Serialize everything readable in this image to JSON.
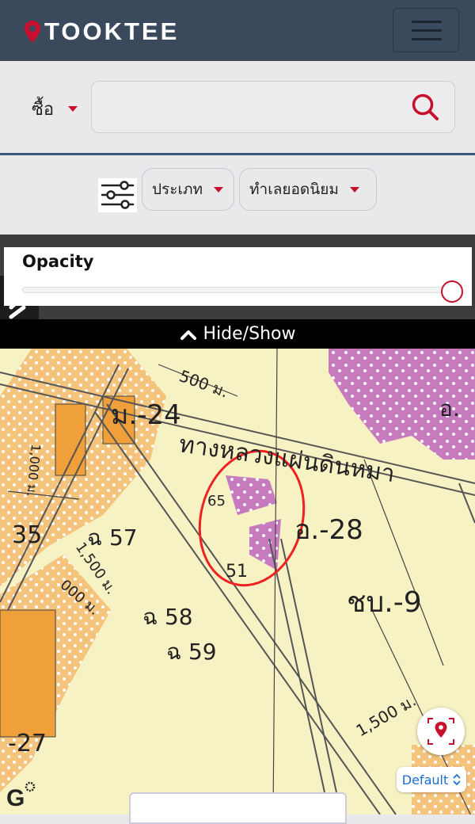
{
  "header": {
    "brand": "TOOKTEE",
    "brand_color": "#3a4a5c",
    "accent": "#c8102e",
    "menu_icon": "hamburger-icon"
  },
  "search": {
    "mode_label": "ซื้อ",
    "placeholder": "",
    "icon": "search-icon"
  },
  "filters": {
    "icon": "sliders-icon",
    "type_label": "ประเภท",
    "location_label": "ทำเลยอดนิยม"
  },
  "opacity": {
    "label": "Opacity",
    "value": 1.0
  },
  "toggle": {
    "label": "Hide/Show"
  },
  "map": {
    "labels": {
      "m24": "ม.-24",
      "a28": "อ.-28",
      "chb9": "ชบ.-9",
      "n57": "ฉ 57",
      "n58": "ฉ 58",
      "n59": "ฉ 59",
      "d500": "500 ม.",
      "d1500": "1,500 ม.",
      "road": "ทางหลวงแผ่นดินหมา",
      "n35": "35",
      "n27": "-27",
      "d1000": "1,000 ม.",
      "d1500b": "1,500 ม.",
      "d000": "000 ม.",
      "a": "อ.",
      "n65": "65",
      "n51": "51"
    },
    "map_type": "Default"
  }
}
